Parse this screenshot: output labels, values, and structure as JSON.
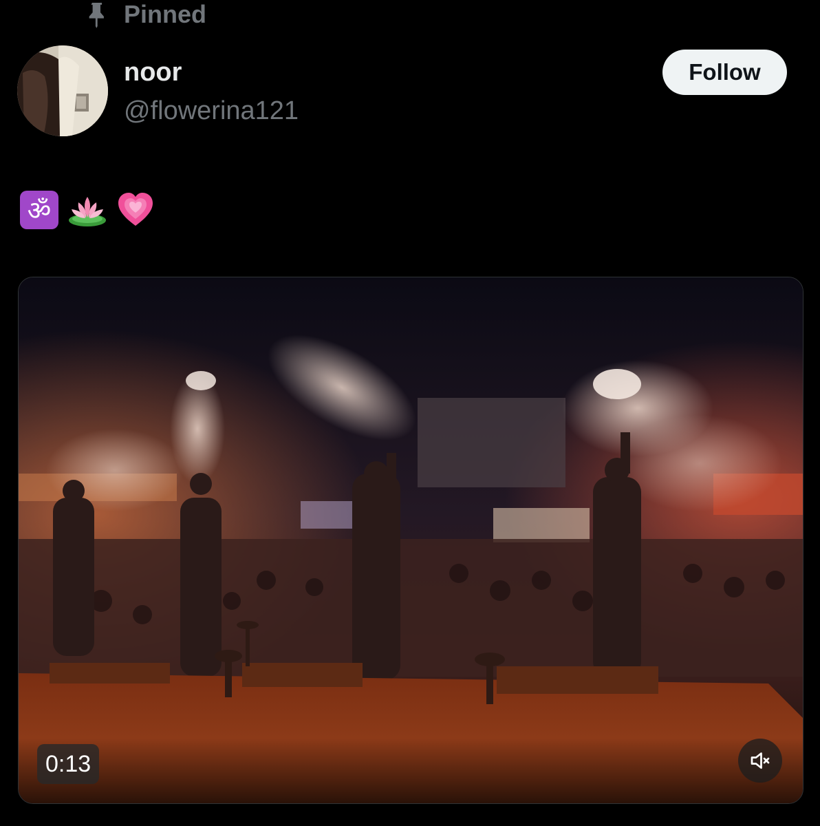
{
  "post": {
    "pinned_label": "Pinned",
    "author": {
      "display_name": "noor",
      "handle": "@flowerina121",
      "avatar_icon": "avatar-image"
    },
    "follow_label": "Follow",
    "text_emojis": [
      "om-symbol",
      "lotus",
      "growing-heart"
    ],
    "media": {
      "type": "video",
      "timestamp": "0:13",
      "muted": true,
      "mute_icon": "speaker-muted-icon"
    }
  },
  "colors": {
    "background": "#000000",
    "primary_text": "#e7e9ea",
    "secondary_text": "#71767b",
    "follow_button_bg": "#eff3f4",
    "follow_button_text": "#0f1419"
  }
}
